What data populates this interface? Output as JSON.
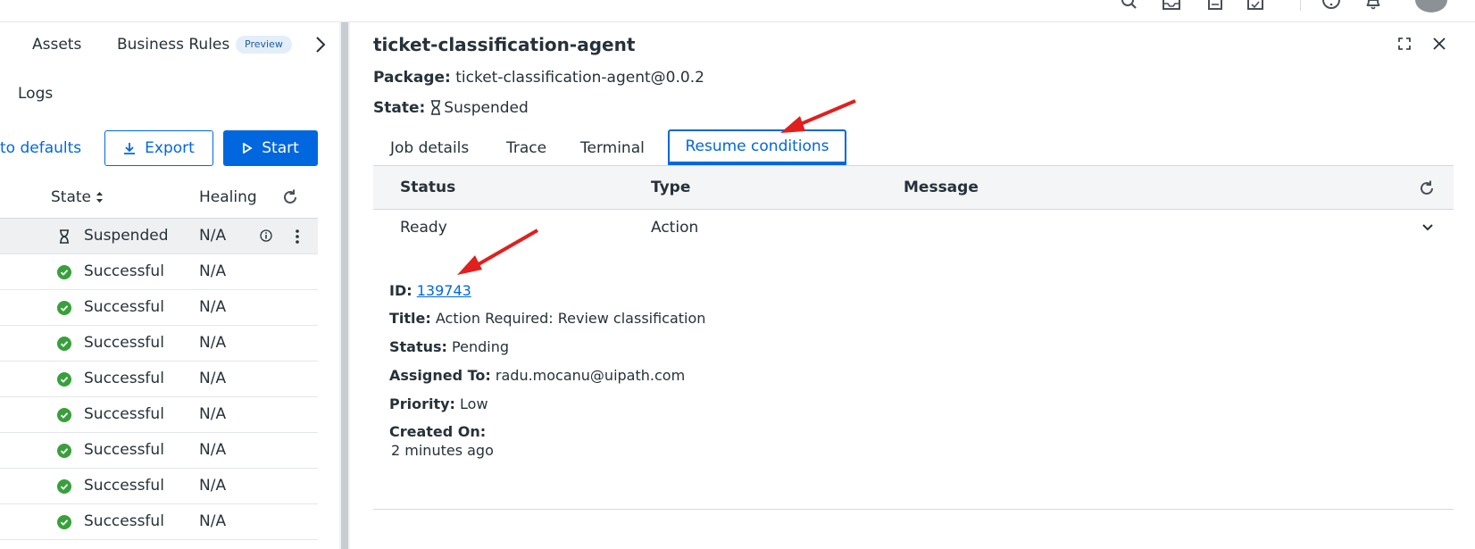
{
  "left": {
    "tabs": {
      "assets": "Assets",
      "business_rules": "Business Rules",
      "preview_badge": "Preview"
    },
    "logs_label": "Logs",
    "reset_link": "to defaults",
    "export_label": "Export",
    "start_label": "Start",
    "table": {
      "state_header": "State",
      "healing_header": "Healing",
      "rows": [
        {
          "state": "Suspended",
          "healing": "N/A",
          "icon": "hourglass-icon"
        },
        {
          "state": "Successful",
          "healing": "N/A",
          "icon": "check-circle-icon"
        },
        {
          "state": "Successful",
          "healing": "N/A",
          "icon": "check-circle-icon"
        },
        {
          "state": "Successful",
          "healing": "N/A",
          "icon": "check-circle-icon"
        },
        {
          "state": "Successful",
          "healing": "N/A",
          "icon": "check-circle-icon"
        },
        {
          "state": "Successful",
          "healing": "N/A",
          "icon": "check-circle-icon"
        },
        {
          "state": "Successful",
          "healing": "N/A",
          "icon": "check-circle-icon"
        },
        {
          "state": "Successful",
          "healing": "N/A",
          "icon": "check-circle-icon"
        },
        {
          "state": "Successful",
          "healing": "N/A",
          "icon": "check-circle-icon"
        }
      ]
    }
  },
  "detail": {
    "title": "ticket-classification-agent",
    "package_label": "Package:",
    "package_value": "ticket-classification-agent@0.0.2",
    "state_label": "State:",
    "state_value": "Suspended",
    "tabs": {
      "job_details": "Job details",
      "trace": "Trace",
      "terminal": "Terminal",
      "resume_conditions": "Resume conditions"
    },
    "active_tab": "Resume conditions",
    "table": {
      "status_header": "Status",
      "type_header": "Type",
      "message_header": "Message",
      "row": {
        "status": "Ready",
        "type": "Action",
        "message": ""
      }
    },
    "action": {
      "id_label": "ID:",
      "id_value": "139743",
      "title_label": "Title:",
      "title_value": "Action Required: Review classification",
      "status_label": "Status:",
      "status_value": "Pending",
      "assigned_label": "Assigned To:",
      "assigned_value": "radu.mocanu@uipath.com",
      "priority_label": "Priority:",
      "priority_value": "Low",
      "created_label": "Created On:",
      "created_value": "2 minutes ago"
    }
  },
  "colors": {
    "accent": "#0067df",
    "success": "#38a03b",
    "annotation_arrow": "#e0201e"
  }
}
